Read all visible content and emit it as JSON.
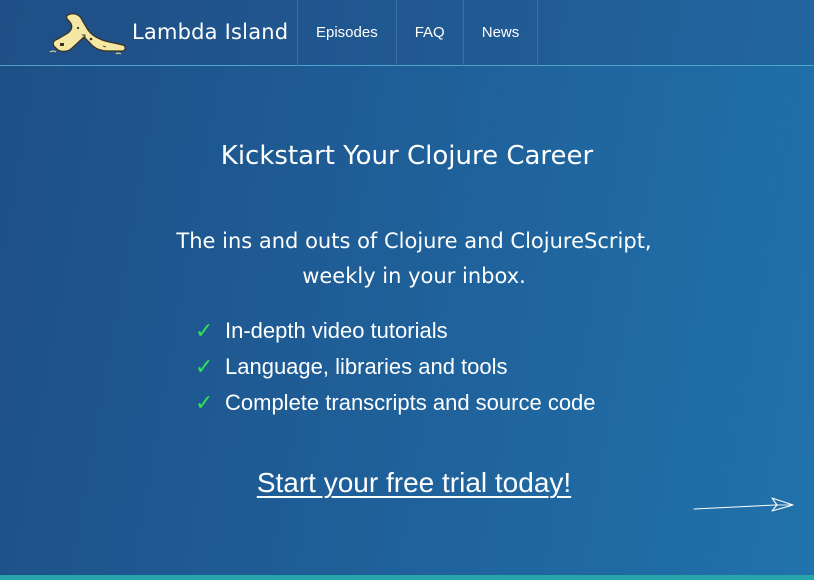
{
  "brand": {
    "name": "Lambda Island",
    "logo_icon": "island-lambda-logo-icon"
  },
  "nav": {
    "items": [
      {
        "label": "Episodes"
      },
      {
        "label": "FAQ"
      },
      {
        "label": "News"
      }
    ]
  },
  "hero": {
    "title": "Kickstart Your Clojure Career",
    "subtitle_line1": "The ins and outs of Clojure and ClojureScript,",
    "subtitle_line2": "weekly in your inbox.",
    "features": [
      {
        "check": "✓",
        "text": "In-depth video tutorials"
      },
      {
        "check": "✓",
        "text": "Language, libraries and tools"
      },
      {
        "check": "✓",
        "text": "Complete transcripts and source code"
      }
    ],
    "cta": "Start your free trial today!",
    "arrow_icon": "paper-plane-arrow-icon"
  },
  "colors": {
    "background_start": "#1e4f86",
    "background_end": "#2172ac",
    "checkmark": "#2fe05a",
    "bottom_bar": "#26a5a9",
    "text": "#ffffff"
  }
}
